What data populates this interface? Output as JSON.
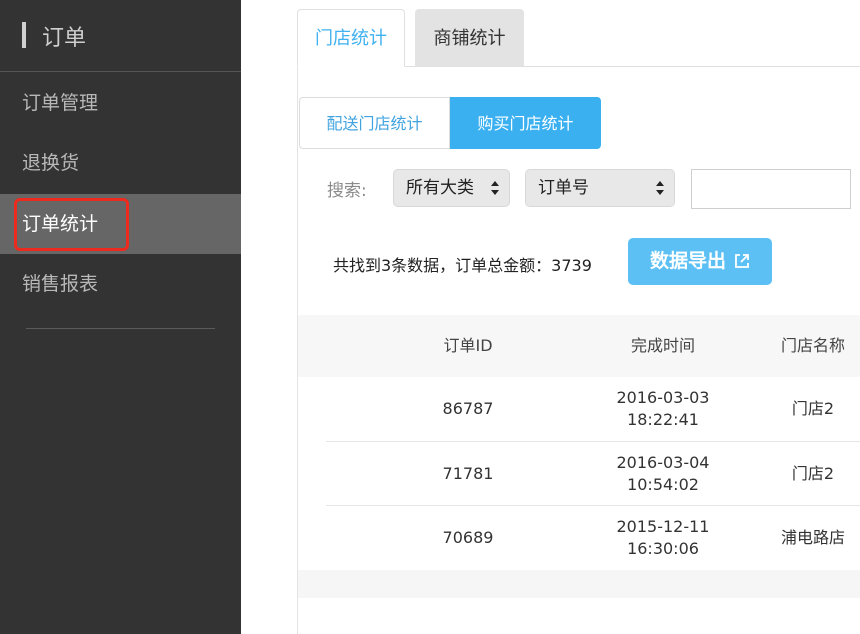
{
  "sidebar": {
    "title": "订单",
    "items": [
      {
        "label": "订单管理"
      },
      {
        "label": "退换货"
      },
      {
        "label": "订单统计"
      },
      {
        "label": "销售报表"
      }
    ]
  },
  "tabs": [
    {
      "label": "门店统计"
    },
    {
      "label": "商铺统计"
    }
  ],
  "segments": [
    {
      "label": "配送门店统计"
    },
    {
      "label": "购买门店统计"
    }
  ],
  "search": {
    "label": "搜索:",
    "category_value": "所有大类",
    "field_value": "订单号",
    "input_value": ""
  },
  "summary": {
    "text": "共找到3条数据，订单总金额：3739",
    "export_label": "数据导出"
  },
  "table": {
    "headers": [
      "订单ID",
      "完成时间",
      "门店名称"
    ],
    "rows": [
      {
        "id": "86787",
        "date": "2016-03-03",
        "time": "18:22:41",
        "store": "门店2"
      },
      {
        "id": "71781",
        "date": "2016-03-04",
        "time": "10:54:02",
        "store": "门店2"
      },
      {
        "id": "70689",
        "date": "2015-12-11",
        "time": "16:30:06",
        "store": "浦电路店"
      }
    ]
  },
  "colors": {
    "sidebar_bg": "#333333",
    "active_item_bg": "#666666",
    "highlight_outline": "#ee2a1f",
    "accent": "#3ab0f0",
    "export_button": "#5cc0f5"
  }
}
